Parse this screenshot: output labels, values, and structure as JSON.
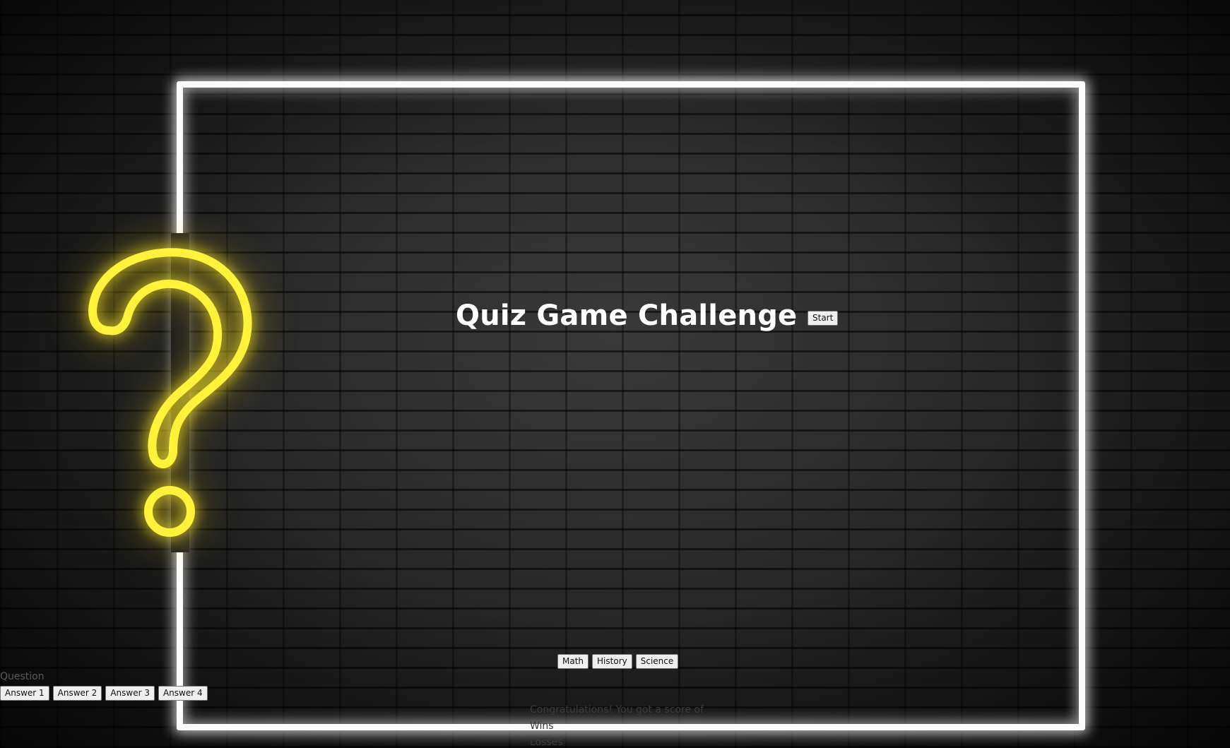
{
  "page": {
    "title": "Quiz Game Challenge",
    "start_label": "Start"
  },
  "categories": [
    "Math",
    "History",
    "Science"
  ],
  "quiz": {
    "question": "Question",
    "answers": [
      "Answer 1",
      "Answer 2",
      "Answer 3",
      "Answer 4"
    ]
  },
  "results": {
    "message": "Congratulations! You got a score of",
    "wins": "Wins",
    "losses": "Losses"
  },
  "colors": {
    "neon_frame": "#fbfbfb",
    "neon_question_mark": "#fff23a",
    "background": "#1b1b1b"
  },
  "icons": {
    "question_mark": "question-mark-icon"
  }
}
